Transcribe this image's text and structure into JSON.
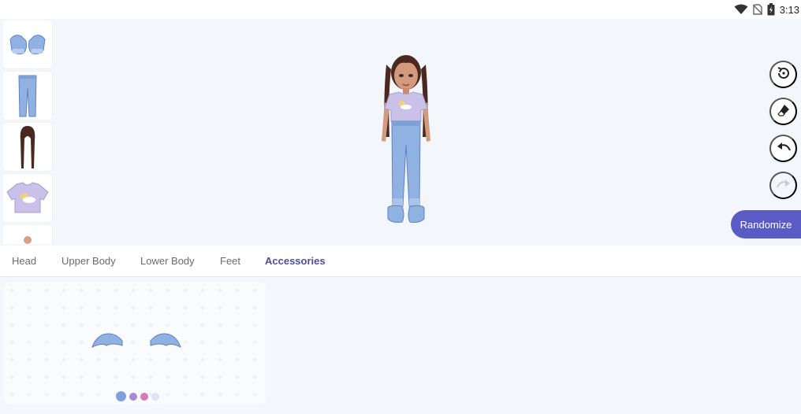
{
  "status_bar": {
    "time": "3:13",
    "icons": [
      "wifi-icon",
      "no-sim-icon",
      "battery-icon"
    ]
  },
  "thumbnails": [
    {
      "name": "shoes-thumbnail"
    },
    {
      "name": "jeans-thumbnail"
    },
    {
      "name": "hair-braids-thumbnail"
    },
    {
      "name": "tshirt-thumbnail"
    },
    {
      "name": "body-thumbnail"
    }
  ],
  "toolbar": {
    "icons": [
      "rotate-icon",
      "eraser-icon",
      "undo-icon",
      "redo-icon"
    ],
    "randomize_label": "Randomize"
  },
  "tabs": [
    {
      "label": "Head",
      "active": false
    },
    {
      "label": "Upper Body",
      "active": false
    },
    {
      "label": "Lower Body",
      "active": false
    },
    {
      "label": "Feet",
      "active": false
    },
    {
      "label": "Accessories",
      "active": true
    }
  ],
  "accessory_card": {
    "item": "wings",
    "color_swatches": [
      "#7f9fe0",
      "#a58ad6",
      "#d27db8",
      "#dfe3f3"
    ],
    "selected_swatch": 0
  },
  "colors": {
    "accent": "#5b5bc6",
    "active_tab": "#4e4e9c",
    "denim": "#8fb2e3",
    "hair": "#4a2a20",
    "shirt": "#c9c1e8"
  }
}
